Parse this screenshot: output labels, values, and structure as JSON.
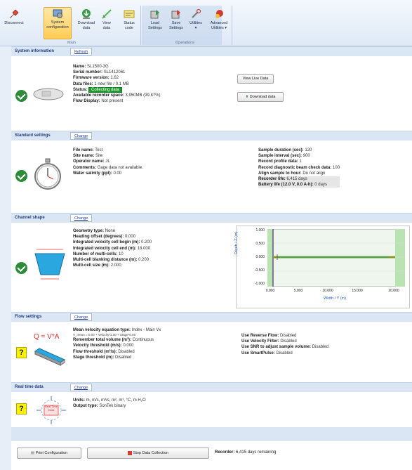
{
  "ribbon": {
    "buttons": [
      {
        "label": "Disconnect",
        "icon": "disconnect-icon"
      },
      {
        "label": "System\nconfiguration",
        "icon": "system-config-icon"
      },
      {
        "label": "Download\ndata",
        "icon": "download-icon"
      },
      {
        "label": "View\ndata",
        "icon": "view-data-icon"
      },
      {
        "label": "Status\ncode",
        "icon": "status-code-icon"
      },
      {
        "label": "Load\nSettings",
        "icon": "load-settings-icon"
      },
      {
        "label": "Save\nSettings",
        "icon": "save-settings-icon"
      },
      {
        "label": "Utilities\n▾",
        "icon": "utilities-icon"
      },
      {
        "label": "Advanced\nUtilities ▾",
        "icon": "advanced-utilities-icon"
      }
    ],
    "group_main": "Main",
    "group_operations": "Operations"
  },
  "system": {
    "title": "System information",
    "action": "Refresh",
    "rows": [
      {
        "k": "Name:",
        "v": "SL1500-3G"
      },
      {
        "k": "Serial number:",
        "v": "SL1412061"
      },
      {
        "k": "Firmware version:",
        "v": "1.62"
      },
      {
        "k": "Data files:",
        "v": "1 new file / 0.1 MB"
      },
      {
        "k": "Status:",
        "v": "Collecting data"
      },
      {
        "k": "Available recorder space:",
        "v": "3,950MB (99.87%)"
      },
      {
        "k": "Flow Display:",
        "v": "Not present"
      }
    ],
    "view_btn": "View Live Data",
    "download_btn": "Download data"
  },
  "standard": {
    "title": "Standard settings",
    "action": "Change",
    "left": [
      {
        "k": "File name:",
        "v": "Test"
      },
      {
        "k": "Site name:",
        "v": "Site"
      },
      {
        "k": "Operator name:",
        "v": "JL"
      },
      {
        "k": "Comments:",
        "v": "Gage data not available."
      },
      {
        "k": "Water salinity (ppt):",
        "v": "0.00"
      }
    ],
    "right": [
      {
        "k": "Sample duration (sec):",
        "v": "120"
      },
      {
        "k": "Sample interval (sec):",
        "v": "900"
      },
      {
        "k": "Record profile data:",
        "v": "1"
      },
      {
        "k": "Record diagnostic beam check data:",
        "v": "100"
      },
      {
        "k": "Align sample to hour:",
        "v": "Do not align"
      },
      {
        "k": "Recorder life:",
        "v": "6,415 days"
      },
      {
        "k": "Battery life (12.0 V, 0.0 A-h):",
        "v": "0 days"
      }
    ]
  },
  "channel": {
    "title": "Channel shape",
    "action": "Change",
    "rows": [
      {
        "k": "Geometry type:",
        "v": "None"
      },
      {
        "k": "Heading offset (degrees):",
        "v": "0.000"
      },
      {
        "k": "Integrated velocity cell begin (m):",
        "v": "0.200"
      },
      {
        "k": "Integrated velocity cell end (m):",
        "v": "18.000"
      },
      {
        "k": "Number of multi-cells:",
        "v": "10"
      },
      {
        "k": "Multi-cell blanking distance (m):",
        "v": "0.200"
      },
      {
        "k": "Multi-cell size (m):",
        "v": "2.000"
      }
    ],
    "chart": {
      "ylabel": "Depth / Z (m)",
      "xlabel": "Width / Y (m)",
      "yticks": [
        "1.000",
        "0.500",
        "0.000",
        "-0.500",
        "-1.000"
      ],
      "xticks": [
        "0.000",
        "5.000",
        "10.000",
        "15.000",
        "20.000"
      ]
    }
  },
  "flow": {
    "title": "Flow settings",
    "action": "Change",
    "formula": "Q = V*A",
    "rows": [
      {
        "k": "Mean velocity equation type:",
        "v": "Index - Main Vx"
      },
      {
        "k": "",
        "v": "V_mean = 0.00 + Velocity*1.00 + Stage*0.00"
      },
      {
        "k": "Remember total volume (m³):",
        "v": "Continuous"
      },
      {
        "k": "Velocity threshold (m/s):",
        "v": "0.000"
      },
      {
        "k": "Flow threshold (m³/s):",
        "v": "Disabled"
      },
      {
        "k": "Stage threshold (m):",
        "v": "Disabled"
      }
    ],
    "right": [
      {
        "k": "Use Reverse Flow:",
        "v": "Disabled"
      },
      {
        "k": "Use Velocity Filter:",
        "v": "Disabled"
      },
      {
        "k": "Use SNR to adjust sample volume:",
        "v": "Disabled"
      },
      {
        "k": "Use SmartPulse:",
        "v": "Disabled"
      }
    ]
  },
  "realtime": {
    "title": "Real time data",
    "action": "Change",
    "icon_label": "Real Time Data",
    "rows": [
      {
        "k": "Units:",
        "v": "m, m/s, m³/s, m², m³, °C, m H₂O"
      },
      {
        "k": "Output type:",
        "v": "SonTek binary"
      }
    ]
  },
  "footer": {
    "print_btn": "Print Configuration",
    "stop_btn": "Stop Data Collection",
    "recorder_label": "Recorder:",
    "recorder_value": "6,415 days remaining"
  },
  "colors": {
    "accent": "#1f3d7a",
    "ok": "#2e8b3a",
    "collecting": "#1e9a2e",
    "warn": "#fff200"
  }
}
